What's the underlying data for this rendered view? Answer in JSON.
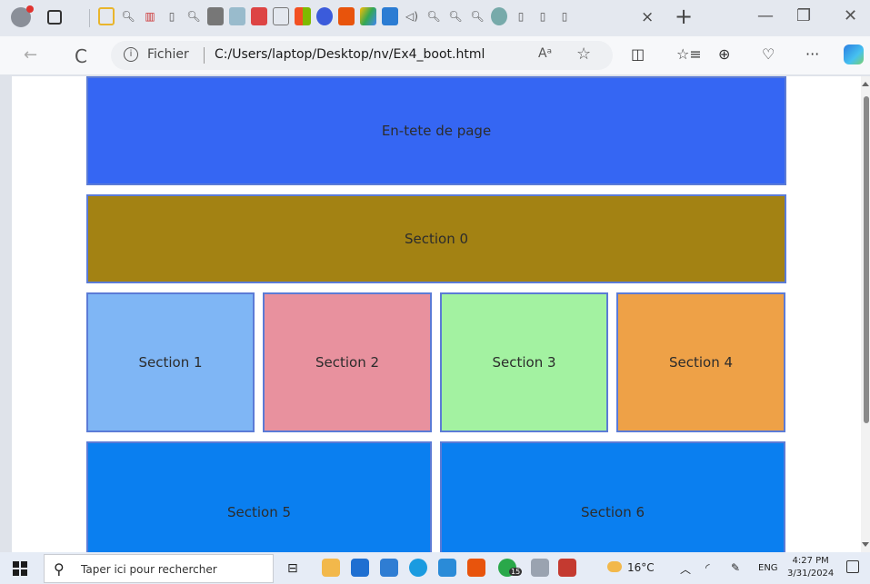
{
  "browser": {
    "tab_close": "×",
    "new_tab": "+",
    "window_controls": {
      "minimize": "—",
      "restore": "❐",
      "close": "✕"
    },
    "nav": {
      "back": "←",
      "refresh": "C"
    },
    "address": {
      "info_icon": "i",
      "scheme_label": "Fichier",
      "url": "C:/Users/laptop/Desktop/nv/Ex4_boot.html",
      "read_aloud": "Aᵃ",
      "favorite": "☆"
    },
    "toolbar": {
      "split": "◫",
      "favorites": "☆≡",
      "collections": "⊕",
      "health": "♡",
      "more": "···"
    }
  },
  "page": {
    "header": {
      "label": "En-tete de page"
    },
    "sections": [
      {
        "label": "Section 0"
      },
      {
        "label": "Section 1"
      },
      {
        "label": "Section 2"
      },
      {
        "label": "Section 3"
      },
      {
        "label": "Section 4"
      },
      {
        "label": "Section 5"
      },
      {
        "label": "Section 6"
      }
    ]
  },
  "taskbar": {
    "search_placeholder": "Taper ici pour rechercher",
    "whatsapp_badge": "15",
    "weather": "16°C",
    "language": "ENG",
    "time": "4:27 PM",
    "date": "3/31/2024"
  },
  "colors": {
    "header": "#3566f3",
    "section0": "#a38213",
    "section1": "#7fb6f5",
    "section2": "#e8919e",
    "section3": "#a3f2a1",
    "section4": "#eea147",
    "section5": "#0a7ff0",
    "section6": "#0a7ff0",
    "border": "#5b7bd6"
  }
}
